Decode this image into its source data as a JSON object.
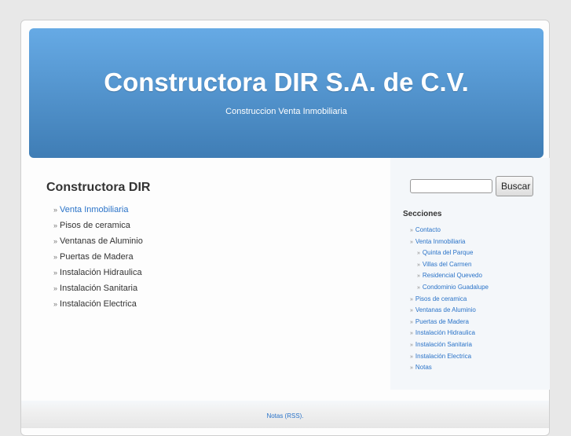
{
  "header": {
    "title": "Constructora DIR S.A. de C.V.",
    "tagline": "Construccion Venta Inmobiliaria"
  },
  "main": {
    "title": "Constructora DIR",
    "items": [
      {
        "label": "Venta Inmobiliaria",
        "link": true
      },
      {
        "label": "Pisos de ceramica"
      },
      {
        "label": "Ventanas de Aluminio"
      },
      {
        "label": "Puertas de Madera"
      },
      {
        "label": "Instalación Hidraulica"
      },
      {
        "label": "Instalación Sanitaria"
      },
      {
        "label": "Instalación Electrica"
      }
    ]
  },
  "sidebar": {
    "search_value": "",
    "search_button": "Buscar",
    "sections_title": "Secciones",
    "items": [
      {
        "label": "Contacto"
      },
      {
        "label": "Venta Inmobiliaria"
      },
      {
        "label": "Quinta del Parque",
        "sub": true
      },
      {
        "label": "Villas del Carmen",
        "sub": true
      },
      {
        "label": "Residencial Quevedo",
        "sub": true
      },
      {
        "label": "Condominio Guadalupe",
        "sub": true
      },
      {
        "label": "Pisos de ceramica"
      },
      {
        "label": "Ventanas de Aluminio"
      },
      {
        "label": "Puertas de Madera"
      },
      {
        "label": "Instalación Hidraulica"
      },
      {
        "label": "Instalación Sanitaria"
      },
      {
        "label": "Instalación Electrica"
      },
      {
        "label": "Notas"
      }
    ]
  },
  "footer": {
    "link": "Notas (RSS)."
  },
  "bullet": "»",
  "colors": {
    "link": "#2a73c8",
    "header_top": "#66aae5",
    "header_bottom": "#3f7db5"
  }
}
